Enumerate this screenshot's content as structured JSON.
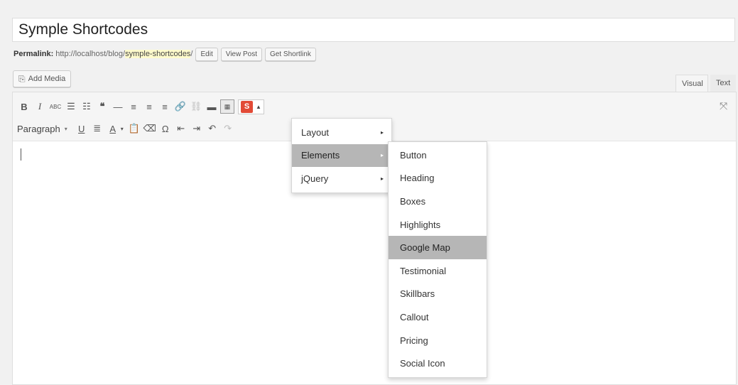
{
  "post_title": "Symple Shortcodes",
  "permalink": {
    "label": "Permalink:",
    "base": "http://localhost/blog/",
    "slug": "symple-shortcodes",
    "trailing": "/",
    "buttons": {
      "edit": "Edit",
      "view_post": "View Post",
      "get_shortlink": "Get Shortlink"
    }
  },
  "add_media_label": "Add Media",
  "tabs": {
    "visual": "Visual",
    "text": "Text"
  },
  "toolbar": {
    "row1_icons": [
      "bold-icon",
      "italic-icon",
      "strikethrough-icon",
      "bullet-list-icon",
      "numbered-list-icon",
      "blockquote-icon",
      "horizontal-rule-icon",
      "align-left-icon",
      "align-center-icon",
      "align-right-icon",
      "link-icon",
      "unlink-icon",
      "read-more-icon",
      "toolbar-toggle-icon",
      "symple-shortcodes-icon"
    ],
    "glyphs": {
      "bold": "B",
      "italic": "I",
      "strike": "ABC",
      "ul": "☰",
      "ol": "☷",
      "quote": "❝",
      "hr": "—",
      "al": "≡",
      "ac": "≡",
      "ar": "≡",
      "link": "🔗",
      "unlink": "⛓",
      "more": "▬",
      "kitchen": "▦",
      "s": "S",
      "s_arrow": "▲",
      "underline": "U",
      "justify": "≣",
      "textcolor": "A",
      "textcolor_caret": "▾",
      "paste": "📋",
      "eraser": "⌫",
      "omega": "Ω",
      "outdent": "⇤",
      "indent": "⇥",
      "undo": "↶",
      "redo": "↷",
      "fullscreen": "⤧",
      "add_media": "⎘"
    },
    "paragraph_format": "Paragraph",
    "paragraph_caret": "▾"
  },
  "shortcode_menu": {
    "items": [
      {
        "label": "Layout",
        "arrow": "▸"
      },
      {
        "label": "Elements",
        "arrow": "▸"
      },
      {
        "label": "jQuery",
        "arrow": "▸"
      }
    ],
    "highlighted": "Elements"
  },
  "elements_submenu": {
    "items": [
      "Button",
      "Heading",
      "Boxes",
      "Highlights",
      "Google Map",
      "Testimonial",
      "Skillbars",
      "Callout",
      "Pricing",
      "Social Icon"
    ],
    "highlighted": "Google Map"
  },
  "colors": {
    "accent": "#e24a36",
    "highlight": "#b6b6b6",
    "slug_highlight": "#fffbcc"
  }
}
